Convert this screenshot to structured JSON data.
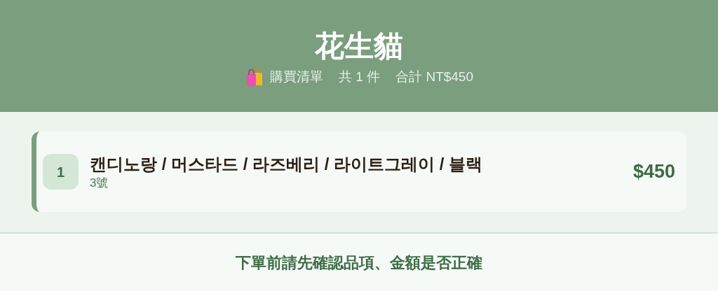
{
  "header": {
    "title": "花生貓",
    "subtitle": [
      "購買清單",
      "共 1 件",
      "合計 NT$450"
    ]
  },
  "items": [
    {
      "index": "1",
      "name": "캔디노랑 / 머스타드 / 라즈베리 / 라이트그레이 / 블랙",
      "size": "3號",
      "price": "$450"
    }
  ],
  "footer": {
    "note": "下單前請先確認品項、金額是否正確"
  }
}
